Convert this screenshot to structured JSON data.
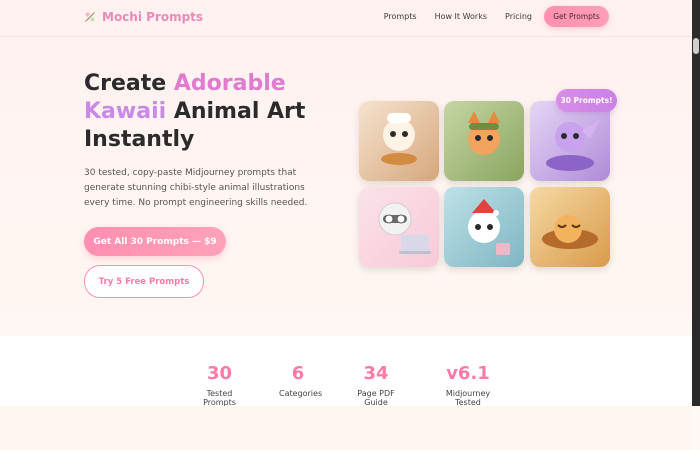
{
  "nav": {
    "brand": "Mochi Prompts",
    "links": [
      "Prompts",
      "How It Works",
      "Pricing"
    ],
    "cta": "Get Prompts"
  },
  "hero": {
    "title_parts": [
      "Create ",
      "Adorable",
      "Kawaii",
      " Animal Art",
      "Instantly"
    ],
    "subtitle": "30 tested, copy-paste Midjourney prompts that generate stunning chibi-style animal illustrations every time. No prompt engineering skills needed.",
    "primary_button": "Get All 30 Prompts — $9",
    "secondary_button": "Try 5 Free Prompts",
    "badge": "30 Prompts!"
  },
  "gallery": {
    "tiles": [
      "chef-cat",
      "forest-fox",
      "purple-dragon",
      "raccoon-laptop",
      "santa-bunny",
      "sleeping-kitten"
    ]
  },
  "stats": [
    {
      "value": "30",
      "label": "Tested Prompts"
    },
    {
      "value": "6",
      "label": "Categories"
    },
    {
      "value": "34",
      "label": "Page PDF Guide"
    },
    {
      "value": "v6.1",
      "label": "Midjourney Tested"
    }
  ],
  "colors": {
    "brand_pink": "#e98ab8",
    "accent_pink": "#ff8fb1",
    "accent_purple": "#c982e4",
    "text_dark": "#2b2b2b"
  }
}
